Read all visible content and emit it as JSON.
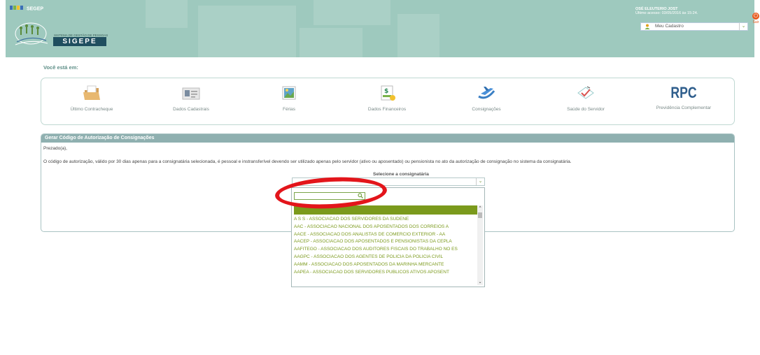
{
  "header": {
    "brand": "SEGEP",
    "system_label": "SISTEMA DE GESTÃO DE PESSOAS",
    "system_name": "SIGEPE",
    "user_name": "OSÉ ELEUTERIO JOST",
    "last_access": "Último acesso: 03/05/2016 às 15:24.",
    "profile_select": "Meu Cadastro",
    "logout_label": "Sair"
  },
  "breadcrumb": {
    "label": "Você está em:"
  },
  "shortcuts": [
    {
      "label": "Último Contracheque",
      "icon": "folder-icon"
    },
    {
      "label": "Dados Cadastrais",
      "icon": "id-card-icon"
    },
    {
      "label": "Férias",
      "icon": "vacation-photo-icon"
    },
    {
      "label": "Dados Financeiros",
      "icon": "money-icon"
    },
    {
      "label": "Consignações",
      "icon": "airplane-icon"
    },
    {
      "label": "Saúde do Servidor",
      "icon": "health-check-icon"
    },
    {
      "label": "Previdência Complementar",
      "icon": "rpc-logo",
      "logo_text": "RPC"
    }
  ],
  "panel": {
    "title": "Gerar Código de Autorização de Consignações",
    "greeting": "Prezado(a),",
    "info_text": "O código de autorização, válido por 30 dias apenas para a consignatária selecionada, é pessoal e instransferível devendo ser utilizado apenas pelo servidor (ativo ou aposentado) ou pensionista no ato da autorização de consignação no sistema da consignatária.",
    "select_label": "Selecione a consignatária",
    "select_value": ""
  },
  "dropdown": {
    "search_value": "",
    "options": [
      "A S S - ASSOCIACAO DOS SERVIDORES DA SUDENE",
      "AAC - ASSOCIACAO NACIONAL DOS APOSENTADOS DOS CORREIOS A",
      "AACE - ASSOCIACAO DOS ANALISTAS DE COMERCIO EXTERIOR - AA",
      "AACEP - ASSOCIACAO DOS APOSENTADOS E PENSIONISTAS DA CEPLA",
      "AAFITEGO - ASSOCIACAO DOS AUDITORES FISCAIS DO TRABALHO NO ES",
      "AAGPC - ASSOCIACAO DOS AGENTES DE POLICIA DA POLICIA CIVIL",
      "AAMM - ASSOCIACAO DOS APOSENTADOS DA MARINHA MERCANTE",
      "AAPEA - ASSOCIACAO DOS SERVIDORES PUBLICOS ATIVOS APOSENT"
    ]
  },
  "colors": {
    "header_bg": "#9ec9be",
    "accent_green": "#7b9a1c",
    "panel_head": "#8fb0b0",
    "annotation_red": "#e3151b",
    "logout_orange": "#e85a1e"
  }
}
